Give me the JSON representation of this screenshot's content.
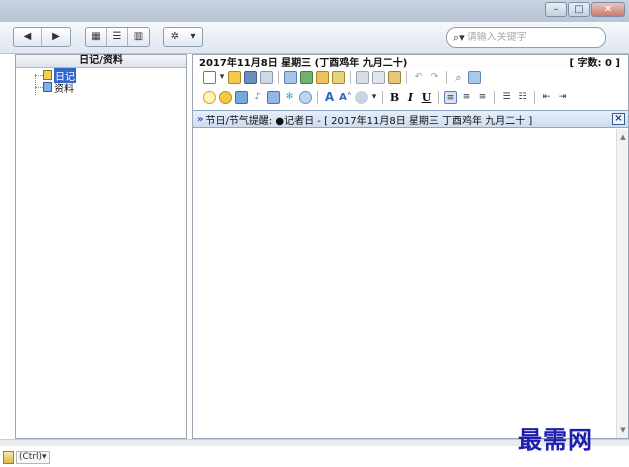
{
  "toolbar": {
    "nav_back": "◀",
    "nav_forward": "▶",
    "view_icons": "▦",
    "view_list": "☰",
    "view_columns": "▥",
    "settings": "✲",
    "settings_arrow": "▾",
    "search_placeholder": "请输入关键字"
  },
  "left_panel": {
    "header": "日记/资料",
    "tree": [
      {
        "label": "日记",
        "icon": "yellow-book-icon",
        "selected": true
      },
      {
        "label": "资料",
        "icon": "blue-book-icon",
        "selected": false
      }
    ]
  },
  "right_panel": {
    "date_header": "2017年11月8日 星期三 (丁酉鸡年 九月二十)",
    "word_count": "[ 字数: 0 ]",
    "notice": "节日/节气提醒: ●记者日 - [ 2017年11月8日 星期三 丁酉鸡年 九月二十 ]",
    "notice_close": "×",
    "format_bold": "B",
    "format_italic": "I",
    "format_underline": "U"
  },
  "watermark": "最需网",
  "paste_hint": "(Ctrl)▾",
  "colors": {
    "accent": "#3366cc",
    "notice_bg": "#dbe6f4",
    "watermark": "#1d1db0"
  }
}
